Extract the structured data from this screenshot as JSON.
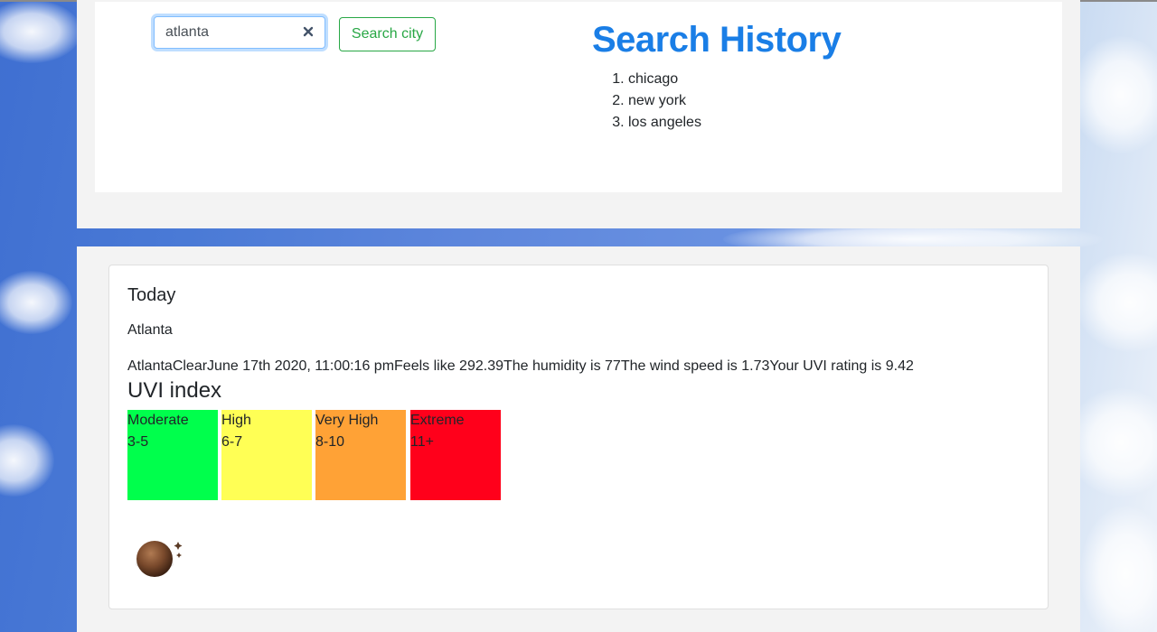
{
  "search": {
    "value": "atlanta",
    "button_label": "Search city"
  },
  "history": {
    "title": "Search History",
    "items": [
      "chicago",
      "new york",
      "los angeles"
    ]
  },
  "today": {
    "title": "Today",
    "city": "Atlanta",
    "details": "AtlantaClearJune 17th 2020, 11:00:16 pmFeels like 292.39The humidity is 77The wind speed is 1.73Your UVI rating is 9.42"
  },
  "uvi": {
    "title": "UVI index",
    "levels": [
      {
        "label": "Moderate",
        "range": "3-5",
        "color": "#00ff4c"
      },
      {
        "label": "High",
        "range": "6-7",
        "color": "#ffff55"
      },
      {
        "label": "Very High",
        "range": "8-10",
        "color": "#ffa236"
      },
      {
        "label": "Extreme",
        "range": "11+",
        "color": "#ff001b"
      }
    ]
  },
  "weather_icon": "clear-night-moon-icon",
  "colors": {
    "accent": "#1a7ee6",
    "success": "#28a745"
  }
}
